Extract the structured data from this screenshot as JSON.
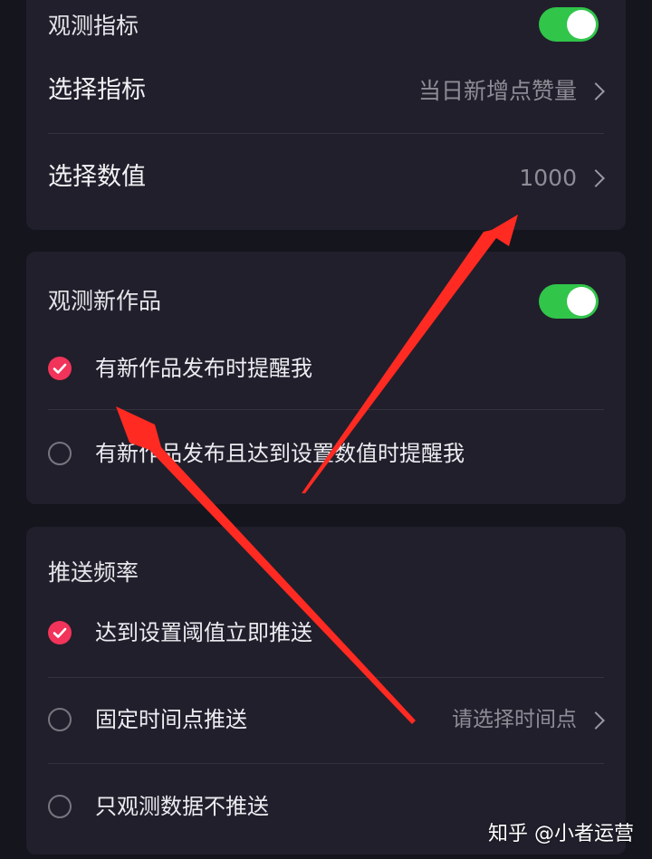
{
  "observe_metric": {
    "header": "观测指标",
    "toggle_on": true,
    "select_metric_label": "选择指标",
    "select_metric_value": "当日新增点赞量",
    "select_value_label": "选择数值",
    "select_value_value": "1000"
  },
  "observe_new_works": {
    "header": "观测新作品",
    "toggle_on": true,
    "options": [
      {
        "label": "有新作品发布时提醒我",
        "checked": true
      },
      {
        "label": "有新作品发布且达到设置数值时提醒我",
        "checked": false
      }
    ]
  },
  "push_frequency": {
    "header": "推送频率",
    "options": [
      {
        "label": "达到设置阈值立即推送",
        "checked": true
      },
      {
        "label": "固定时间点推送",
        "checked": false,
        "value": "请选择时间点"
      },
      {
        "label": "只观测数据不推送",
        "checked": false
      }
    ]
  },
  "watermark": "知乎 @小者运营",
  "colors": {
    "background": "#15151d",
    "card": "#211f2b",
    "toggle_on": "#31c54a",
    "check_accent": "#f2335a",
    "annotation_arrow": "#ff2a22"
  },
  "icons": {
    "chevron": "chevron-right-icon",
    "check": "check-icon"
  }
}
